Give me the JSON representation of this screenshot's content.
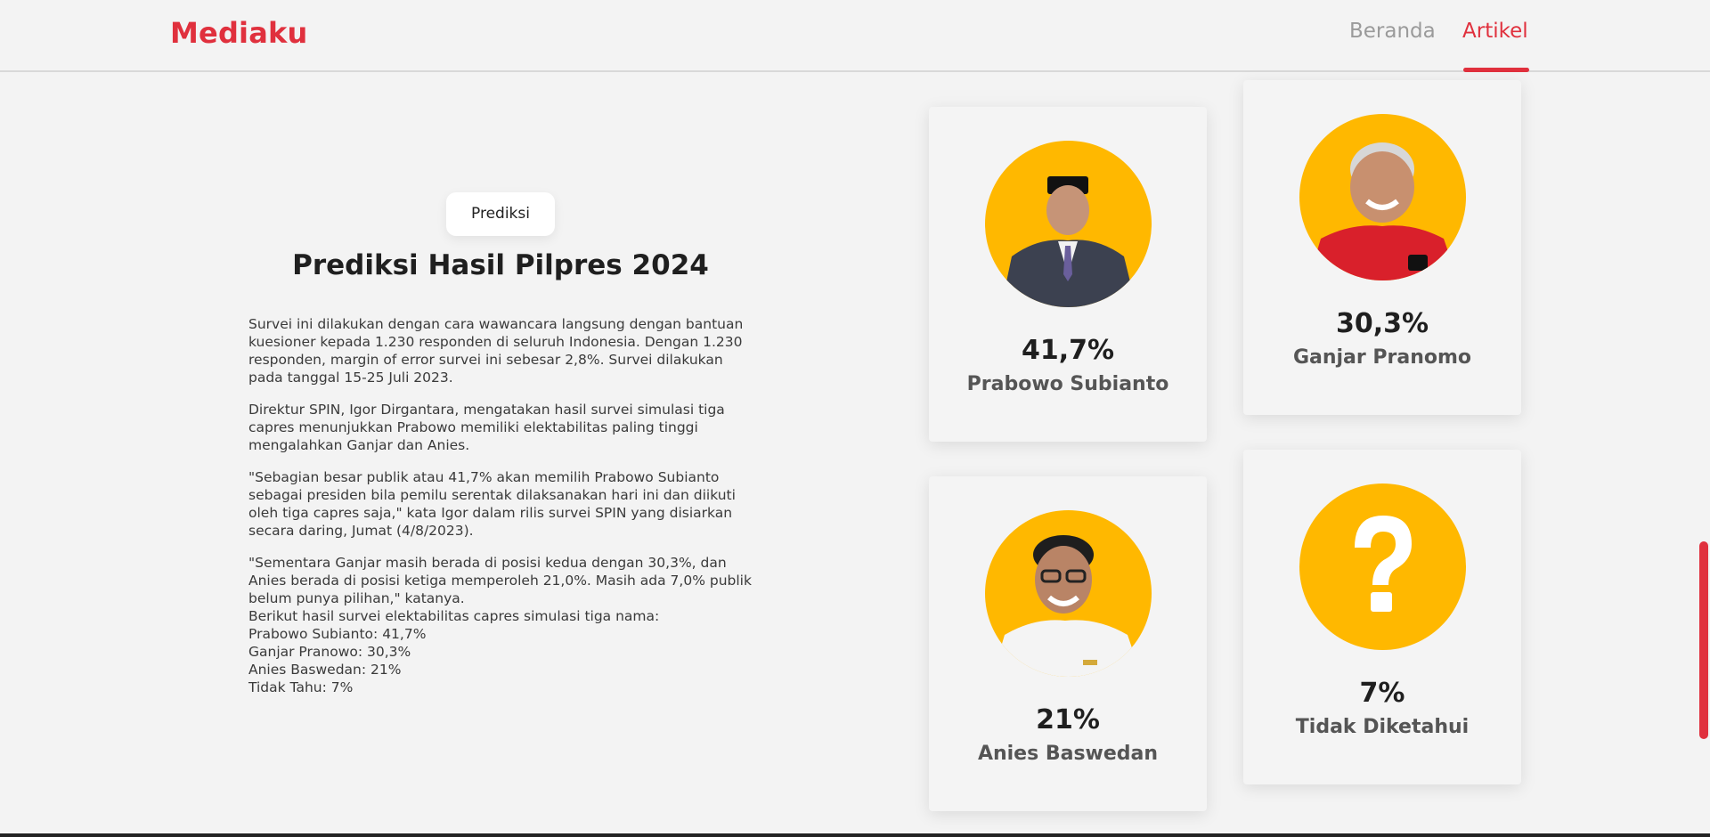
{
  "brand": "Mediaku",
  "nav": {
    "home": "Beranda",
    "article": "Artikel",
    "active": "Artikel"
  },
  "badge": "Prediksi",
  "title": "Prediksi Hasil Pilpres 2024",
  "article": {
    "p1": "Survei ini dilakukan dengan cara wawancara langsung dengan bantuan kuesioner kepada 1.230 responden di seluruh Indonesia. Dengan 1.230 responden, margin of error survei ini sebesar 2,8%. Survei dilakukan pada tanggal 15-25 Juli 2023.",
    "p2": "Direktur SPIN, Igor Dirgantara, mengatakan hasil survei simulasi tiga capres menunjukkan Prabowo memiliki elektabilitas paling tinggi mengalahkan Ganjar dan Anies.",
    "p3": "\"Sebagian besar publik atau 41,7% akan memilih Prabowo Subianto sebagai presiden bila pemilu serentak dilaksanakan hari ini dan diikuti oleh tiga capres saja,\" kata Igor dalam rilis survei SPIN yang disiarkan secara daring, Jumat (4/8/2023).",
    "p4": "\"Sementara Ganjar masih berada di posisi kedua dengan 30,3%, dan Anies berada di posisi ketiga memperoleh 21,0%. Masih ada 7,0% publik belum punya pilihan,\" katanya.",
    "list_intro": "Berikut hasil survei elektabilitas capres simulasi tiga nama:",
    "list": [
      "Prabowo Subianto: 41,7%",
      "Ganjar Pranowo: 30,3%",
      "Anies Baswedan: 21%",
      "Tidak Tahu: 7%"
    ]
  },
  "candidates": [
    {
      "name": "Prabowo Subianto",
      "percent": "41,7%"
    },
    {
      "name": "Ganjar Pranomo",
      "percent": "30,3%"
    },
    {
      "name": "Anies Baswedan",
      "percent": "21%"
    },
    {
      "name": "Tidak Diketahui",
      "percent": "7%"
    }
  ],
  "colors": {
    "brand": "#e0303d",
    "avatar_bg": "#ffb800",
    "background": "#f3f3f3"
  }
}
